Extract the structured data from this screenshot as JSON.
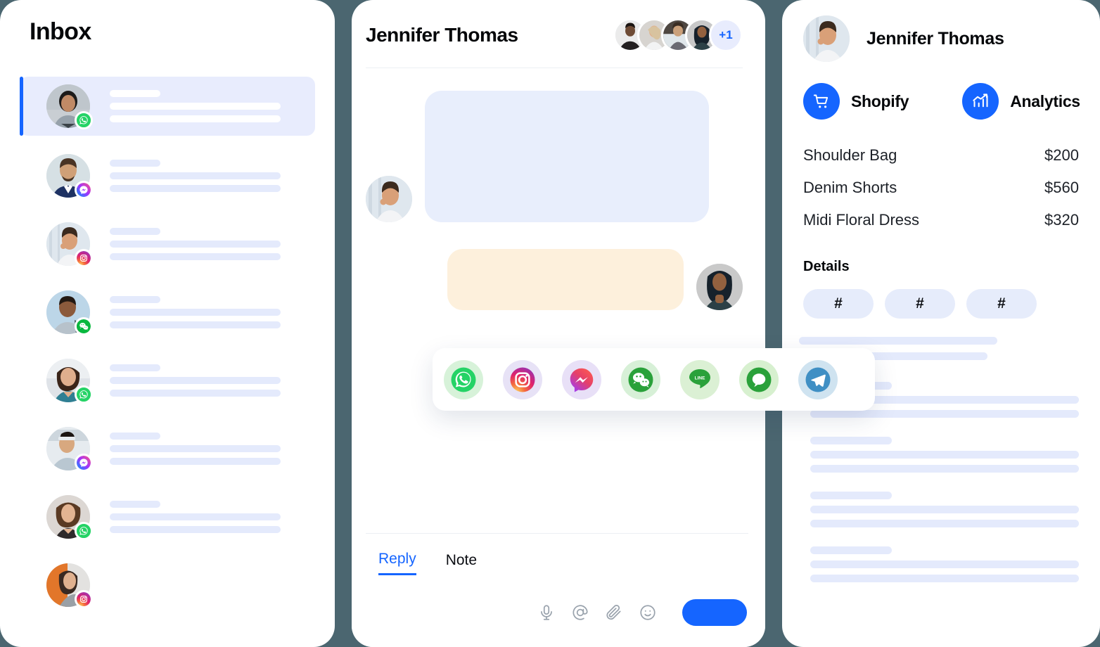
{
  "theme": {
    "background": "#4b6670",
    "panel": "#ffffff",
    "accent": "#1565ff",
    "skeleton": "#e4eafc",
    "selected_row": "#e8ecfd",
    "bubble_in": "#e8eefc",
    "bubble_out": "#fdf0dc",
    "tag_pill": "#e6ecfb"
  },
  "inbox": {
    "title": "Inbox",
    "rows": [
      {
        "name": "inbox-row-1",
        "channel": "whatsapp-icon",
        "selected": true
      },
      {
        "name": "inbox-row-2",
        "channel": "messenger-icon",
        "selected": false
      },
      {
        "name": "inbox-row-3",
        "channel": "instagram-icon",
        "selected": false
      },
      {
        "name": "inbox-row-4",
        "channel": "wechat-icon",
        "selected": false
      },
      {
        "name": "inbox-row-5",
        "channel": "whatsapp-icon",
        "selected": false
      },
      {
        "name": "inbox-row-6",
        "channel": "messenger-icon",
        "selected": false
      },
      {
        "name": "inbox-row-7",
        "channel": "whatsapp-icon",
        "selected": false
      },
      {
        "name": "inbox-row-8",
        "channel": "instagram-icon",
        "selected": false
      }
    ]
  },
  "chat": {
    "title": "Jennifer Thomas",
    "participants_overflow": "+1",
    "participant_count": 4,
    "channels": [
      {
        "id": "whatsapp",
        "label": "WhatsApp"
      },
      {
        "id": "instagram",
        "label": "Instagram"
      },
      {
        "id": "messenger",
        "label": "Messenger"
      },
      {
        "id": "wechat",
        "label": "WeChat"
      },
      {
        "id": "line",
        "label": "LINE"
      },
      {
        "id": "kakaotalk",
        "label": "KakaoTalk"
      },
      {
        "id": "telegram",
        "label": "Telegram"
      }
    ],
    "composer": {
      "tabs": [
        {
          "label": "Reply",
          "selected": true
        },
        {
          "label": "Note",
          "selected": false
        }
      ],
      "icons": [
        "microphone-icon",
        "mention-icon",
        "attachment-icon",
        "emoji-icon"
      ],
      "send_label": ""
    }
  },
  "profile": {
    "name": "Jennifer Thomas",
    "apps": [
      {
        "label": "Shopify",
        "icon": "shopping-cart-icon"
      },
      {
        "label": "Analytics",
        "icon": "analytics-chart-icon"
      }
    ],
    "order_items": [
      {
        "name": "Shoulder Bag",
        "price": "$200"
      },
      {
        "name": "Denim Shorts",
        "price": "$560"
      },
      {
        "name": "Midi Floral Dress",
        "price": "$320"
      }
    ],
    "details_title": "Details",
    "tags": [
      "#",
      "#",
      "#"
    ]
  }
}
